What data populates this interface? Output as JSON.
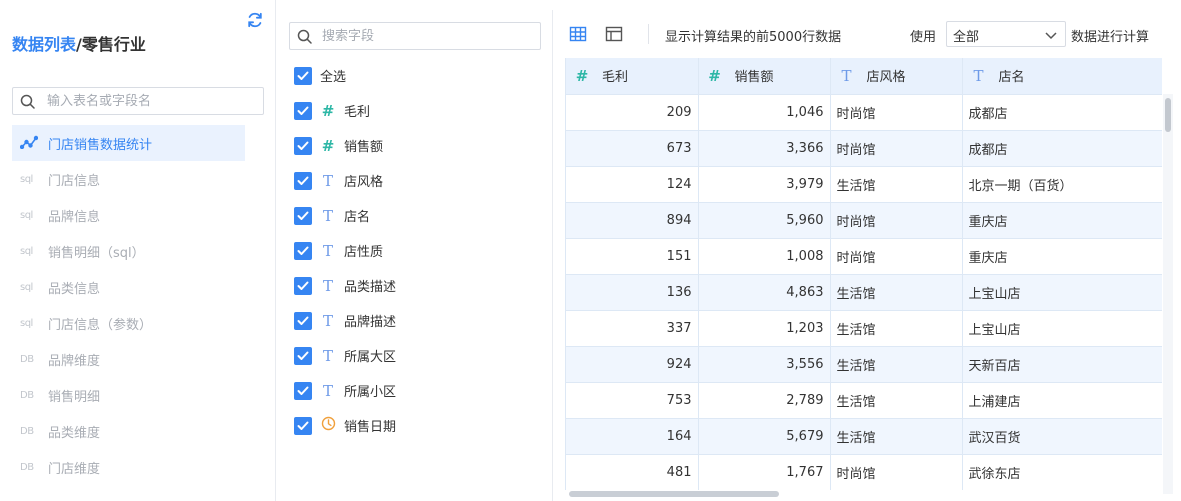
{
  "breadcrumb": {
    "list_label": "数据列表",
    "sep": "/",
    "package": "零售行业"
  },
  "left_search": {
    "placeholder": "输入表名或字段名"
  },
  "tables": [
    {
      "icon": "chart",
      "label": "门店销售数据统计",
      "active": true
    },
    {
      "icon": "sql",
      "label": "门店信息"
    },
    {
      "icon": "sql",
      "label": "品牌信息"
    },
    {
      "icon": "sql",
      "label": "销售明细（sql）"
    },
    {
      "icon": "sql",
      "label": "品类信息"
    },
    {
      "icon": "sql",
      "label": "门店信息（参数）"
    },
    {
      "icon": "DB",
      "label": "品牌维度"
    },
    {
      "icon": "DB",
      "label": "销售明细"
    },
    {
      "icon": "DB",
      "label": "品类维度"
    },
    {
      "icon": "DB",
      "label": "门店维度"
    }
  ],
  "field_search": {
    "placeholder": "搜索字段"
  },
  "select_all": {
    "label": "全选"
  },
  "fields": [
    {
      "type": "#",
      "label": "毛利"
    },
    {
      "type": "#",
      "label": "销售额"
    },
    {
      "type": "T",
      "label": "店风格"
    },
    {
      "type": "T",
      "label": "店名"
    },
    {
      "type": "T",
      "label": "店性质"
    },
    {
      "type": "T",
      "label": "品类描述"
    },
    {
      "type": "T",
      "label": "品牌描述"
    },
    {
      "type": "T",
      "label": "所属大区"
    },
    {
      "type": "T",
      "label": "所属小区"
    },
    {
      "type": "date",
      "label": "销售日期"
    }
  ],
  "toolbar": {
    "info": "显示计算结果的前5000行数据",
    "use_label": "使用",
    "scope_value": "全部",
    "calc_label": "数据进行计算"
  },
  "colors": {
    "accent": "#3685f2",
    "number_type": "#2db7a6",
    "text_type": "#6f9be8",
    "date_type": "#f0a03c"
  },
  "grid": {
    "headers": [
      {
        "type": "#",
        "label": "毛利"
      },
      {
        "type": "#",
        "label": "销售额"
      },
      {
        "type": "T",
        "label": "店风格"
      },
      {
        "type": "T",
        "label": "店名"
      }
    ],
    "rows": [
      [
        "209",
        "1,046",
        "时尚馆",
        "成都店"
      ],
      [
        "673",
        "3,366",
        "时尚馆",
        "成都店"
      ],
      [
        "124",
        "3,979",
        "生活馆",
        "北京一期（百货）"
      ],
      [
        "894",
        "5,960",
        "时尚馆",
        "重庆店"
      ],
      [
        "151",
        "1,008",
        "时尚馆",
        "重庆店"
      ],
      [
        "136",
        "4,863",
        "生活馆",
        "上宝山店"
      ],
      [
        "337",
        "1,203",
        "生活馆",
        "上宝山店"
      ],
      [
        "924",
        "3,556",
        "生活馆",
        "天新百店"
      ],
      [
        "753",
        "2,789",
        "生活馆",
        "上浦建店"
      ],
      [
        "164",
        "5,679",
        "生活馆",
        "武汉百货"
      ],
      [
        "481",
        "1,767",
        "时尚馆",
        "武徐东店"
      ]
    ]
  }
}
